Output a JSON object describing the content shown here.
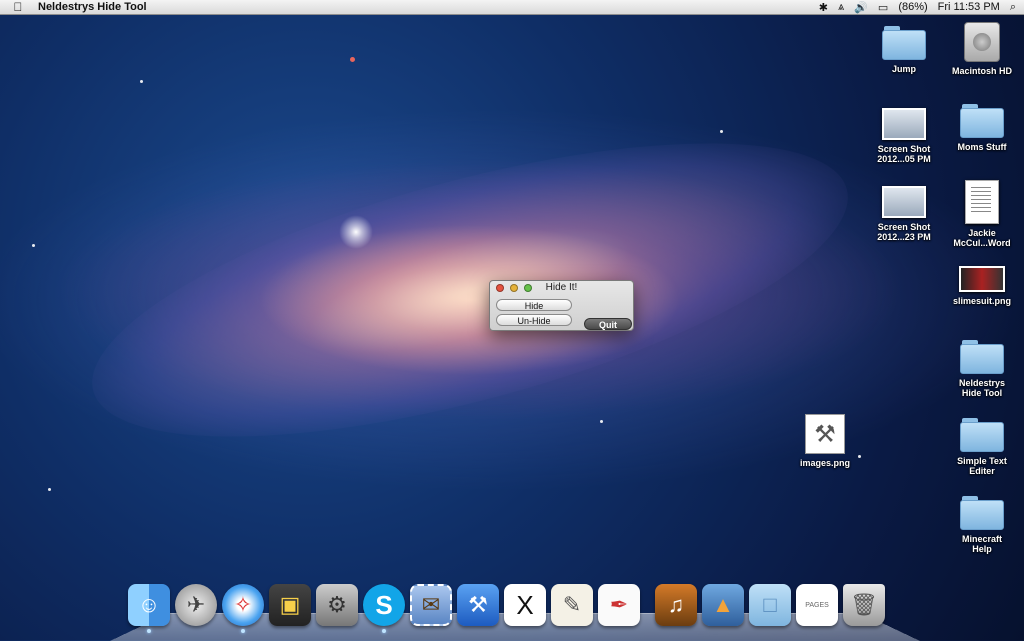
{
  "menubar": {
    "app_name": "Neldestrys Hide Tool",
    "battery": "(86%)",
    "clock": "Fri 11:53 PM"
  },
  "desktop_icons": [
    {
      "label": "Jump",
      "kind": "folder"
    },
    {
      "label": "Macintosh HD",
      "kind": "drive"
    },
    {
      "label": "Screen Shot\n2012...05 PM",
      "kind": "screenshot"
    },
    {
      "label": "Moms Stuff",
      "kind": "folder"
    },
    {
      "label": "Screen Shot\n2012...23 PM",
      "kind": "screenshot"
    },
    {
      "label": "Jackie\nMcCul...Word",
      "kind": "document"
    },
    {
      "label": "slimesuit.png",
      "kind": "image"
    },
    {
      "label": "Neldestrys\nHide Tool",
      "kind": "folder"
    },
    {
      "label": "images.png",
      "kind": "image"
    },
    {
      "label": "Simple Text\nEditer",
      "kind": "folder"
    },
    {
      "label": "Minecraft\nHelp",
      "kind": "folder"
    }
  ],
  "window": {
    "title": "Hide It!",
    "hide_label": "Hide",
    "unhide_label": "Un-Hide",
    "quit_label": "Quit"
  },
  "dock": {
    "items": [
      {
        "name": "finder-icon",
        "running": true
      },
      {
        "name": "launchpad-icon",
        "running": false
      },
      {
        "name": "safari-icon",
        "running": true
      },
      {
        "name": "photo-browser-icon",
        "running": false
      },
      {
        "name": "system-preferences-icon",
        "running": false
      },
      {
        "name": "skype-icon",
        "running": true
      },
      {
        "name": "mail-stamp-icon",
        "running": false
      },
      {
        "name": "xcode-icon",
        "running": false
      },
      {
        "name": "x11-icon",
        "running": false
      },
      {
        "name": "textedit-icon",
        "running": false
      },
      {
        "name": "pages-pen-icon",
        "running": false
      },
      {
        "name": "garageband-icon",
        "running": false
      },
      {
        "name": "keynote-icon",
        "running": false
      },
      {
        "name": "applications-folder-icon",
        "running": false
      },
      {
        "name": "document-stack-icon",
        "running": false
      },
      {
        "name": "trash-icon",
        "running": false
      }
    ],
    "pages_badge": "PAGES"
  }
}
